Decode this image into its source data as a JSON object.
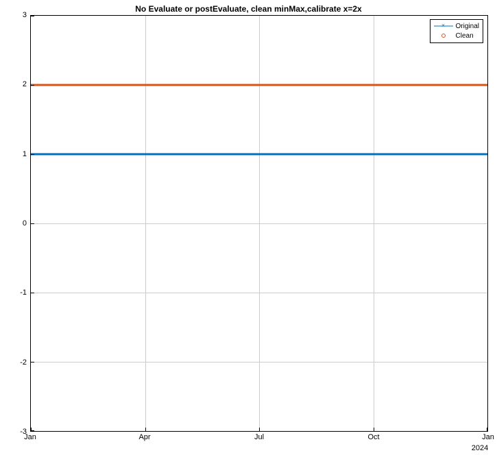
{
  "title": "No Evaluate or postEvaluate, clean minMax,calibrate x=2x",
  "year_label": "2024",
  "yticks": [
    "-3",
    "-2",
    "-1",
    "0",
    "1",
    "2",
    "3"
  ],
  "xticks": [
    "Jan",
    "Apr",
    "Jul",
    "Oct",
    "Jan"
  ],
  "legend": {
    "original": "Original",
    "clean": "Clean"
  },
  "colors": {
    "original": "#0072bd",
    "clean": "#d95319"
  },
  "chart_data": {
    "type": "line",
    "title": "No Evaluate or postEvaluate, clean minMax,calibrate x=2x",
    "xlabel": "",
    "ylabel": "",
    "ylim": [
      -3,
      3
    ],
    "x_categories": [
      "Jan",
      "Apr",
      "Jul",
      "Oct",
      "Jan"
    ],
    "x_year": "2024",
    "series": [
      {
        "name": "Original",
        "color": "#0072bd",
        "marker": "x",
        "values": [
          1,
          1,
          1,
          1,
          1
        ]
      },
      {
        "name": "Clean",
        "color": "#d95319",
        "marker": "o",
        "values": [
          2,
          2,
          2,
          2,
          2
        ]
      }
    ]
  }
}
